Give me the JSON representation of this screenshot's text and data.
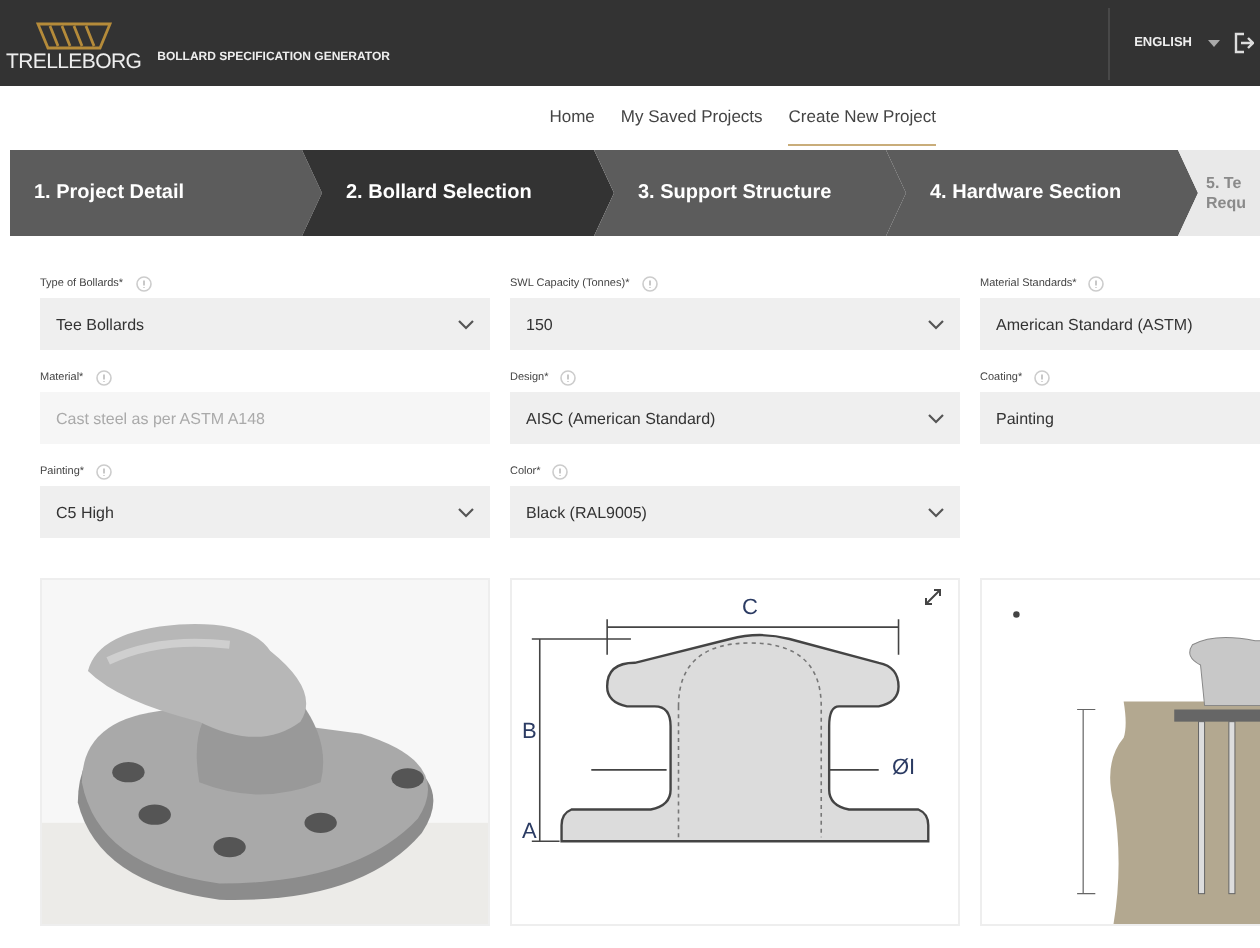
{
  "header": {
    "brand": "TRELLEBORG",
    "app_title": "BOLLARD SPECIFICATION GENERATOR",
    "language": "ENGLISH"
  },
  "nav": [
    {
      "label": "Home",
      "selected": false
    },
    {
      "label": "My Saved Projects",
      "selected": false
    },
    {
      "label": "Create New Project",
      "selected": true
    }
  ],
  "steps": [
    {
      "label": "1. Project Detail",
      "selected": false,
      "disabled": false
    },
    {
      "label": "2. Bollard Selection",
      "selected": true,
      "disabled": false
    },
    {
      "label": "3. Support Structure",
      "selected": false,
      "disabled": false
    },
    {
      "label": "4. Hardware Section",
      "selected": false,
      "disabled": false
    },
    {
      "label": "5. Te Requ",
      "selected": false,
      "disabled": true
    }
  ],
  "fields": [
    {
      "label": "Type of Bollards*",
      "value": "Tee Bollards",
      "disabled": false,
      "dropdown_arrow": true
    },
    {
      "label": "SWL Capacity (Tonnes)*",
      "value": "150",
      "disabled": false,
      "dropdown_arrow": true
    },
    {
      "label": "Material Standards*",
      "value": "American Standard (ASTM)",
      "disabled": false,
      "dropdown_arrow": false
    },
    {
      "label": "Material*",
      "value": "Cast steel as per ASTM A148",
      "disabled": true,
      "dropdown_arrow": false
    },
    {
      "label": "Design*",
      "value": "AISC (American Standard)",
      "disabled": false,
      "dropdown_arrow": true
    },
    {
      "label": "Coating*",
      "value": "Painting",
      "disabled": false,
      "dropdown_arrow": false
    },
    {
      "label": "Painting*",
      "value": "C5 High",
      "disabled": false,
      "dropdown_arrow": true
    },
    {
      "label": "Color*",
      "value": "Black (RAL9005)",
      "disabled": false,
      "dropdown_arrow": true
    }
  ],
  "images": [
    {
      "kind": "picture"
    },
    {
      "kind": "dimension_drawing",
      "labels": {
        "c": "C",
        "b": "B",
        "a": "A",
        "d": "ØI"
      }
    },
    {
      "kind": "installation_drawing"
    }
  ]
}
